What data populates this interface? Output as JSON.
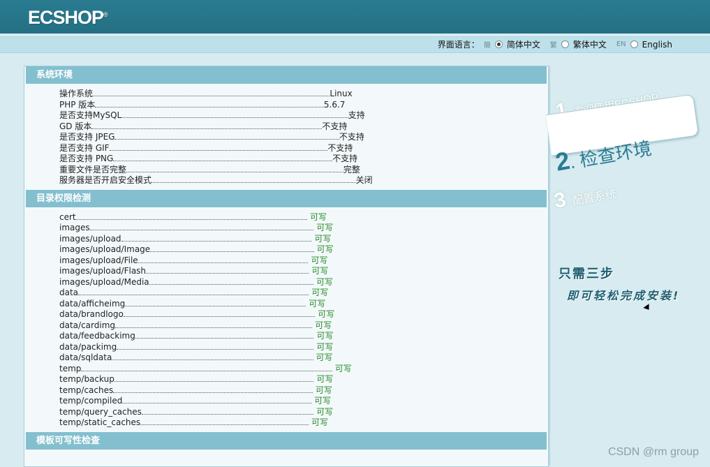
{
  "brand": {
    "logo_text": "ECSHOP",
    "reg_mark": "®"
  },
  "lang": {
    "label": "界面语言：",
    "options": [
      {
        "badge": "簡",
        "label": "简体中文",
        "selected": true
      },
      {
        "badge": "繁",
        "label": "繁体中文",
        "selected": false
      },
      {
        "badge": "EN",
        "label": "English",
        "selected": false
      }
    ]
  },
  "env": {
    "title": "系统环境",
    "rows": [
      {
        "label": "操作系统",
        "value": "Linux"
      },
      {
        "label": "PHP 版本",
        "value": "5.6.7"
      },
      {
        "label": "是否支持MySQL",
        "value": "支持"
      },
      {
        "label": "GD 版本",
        "value": "不支持"
      },
      {
        "label": "是否支持 JPEG",
        "value": "不支持"
      },
      {
        "label": "是否支持 GIF",
        "value": "不支持"
      },
      {
        "label": "是否支持 PNG",
        "value": "不支持"
      },
      {
        "label": "重要文件是否完整",
        "value": "完整"
      },
      {
        "label": "服务器是否开启安全模式",
        "value": "关闭"
      }
    ]
  },
  "dirs": {
    "title": "目录权限检测",
    "rows": [
      {
        "label": "cert",
        "value": "可写"
      },
      {
        "label": "images",
        "value": "可写"
      },
      {
        "label": "images/upload",
        "value": "可写"
      },
      {
        "label": "images/upload/Image",
        "value": "可写"
      },
      {
        "label": "images/upload/File",
        "value": "可写"
      },
      {
        "label": "images/upload/Flash",
        "value": "可写"
      },
      {
        "label": "images/upload/Media",
        "value": "可写"
      },
      {
        "label": "data",
        "value": "可写"
      },
      {
        "label": "data/afficheimg",
        "value": "可写"
      },
      {
        "label": "data/brandlogo",
        "value": "可写"
      },
      {
        "label": "data/cardimg",
        "value": "可写"
      },
      {
        "label": "data/feedbackimg",
        "value": "可写"
      },
      {
        "label": "data/packimg",
        "value": "可写"
      },
      {
        "label": "data/sqldata",
        "value": "可写"
      },
      {
        "label": "temp",
        "value": "可写"
      },
      {
        "label": "temp/backup",
        "value": "可写"
      },
      {
        "label": "temp/caches",
        "value": "可写"
      },
      {
        "label": "temp/compiled",
        "value": "可写"
      },
      {
        "label": "temp/query_caches",
        "value": "可写"
      },
      {
        "label": "temp/static_caches",
        "value": "可写"
      }
    ]
  },
  "template_check": {
    "title": "模板可写性检查"
  },
  "steps": {
    "s1_num": "1",
    "s1_text": ". 欢迎使用ECSHOP",
    "s2_num": "2",
    "s2_text": ". 检查环境",
    "s3_num": "3",
    "s3_text": ". 配置系统"
  },
  "slogan": {
    "line1": "只需三步",
    "line2": "即可轻松完成安装!"
  },
  "watermark": "CSDN @rm group",
  "colors": {
    "header": "#2a7c91",
    "section_head": "#83bfcf",
    "ok_text": "#2a8a2a"
  }
}
